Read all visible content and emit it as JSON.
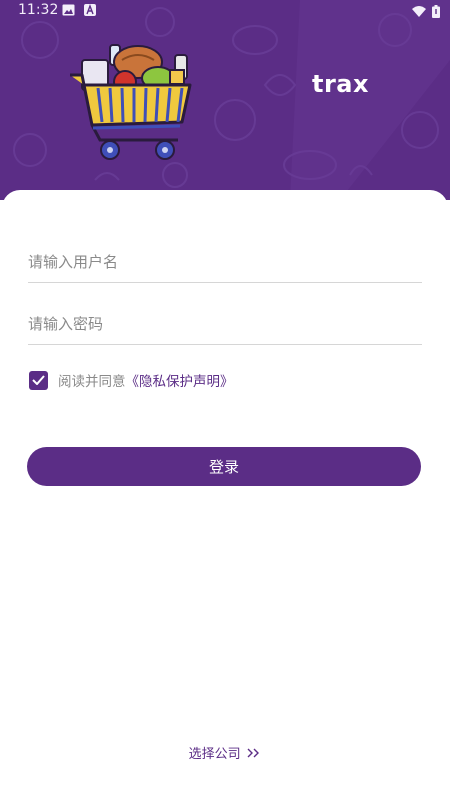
{
  "colors": {
    "brand": "#5b2d86",
    "background": "#ffffff",
    "placeholder": "#8a8a8a",
    "divider": "#d6d6d6"
  },
  "status_bar": {
    "time": "11:32",
    "icons": [
      "image-icon",
      "a-notification-icon",
      "wifi-icon",
      "battery-icon"
    ]
  },
  "header": {
    "logo_prefix": "tra",
    "logo_suffix": "x",
    "illustration": "shopping-cart-with-groceries"
  },
  "form": {
    "username_placeholder": "请输入用户名",
    "password_placeholder": "请输入密码",
    "agree_checked": true,
    "agree_text": "阅读并同意",
    "privacy_link": "《隐私保护声明》",
    "login_label": "登录"
  },
  "footer": {
    "select_company_label": "选择公司",
    "select_company_icon": "double-chevron-right-icon"
  }
}
